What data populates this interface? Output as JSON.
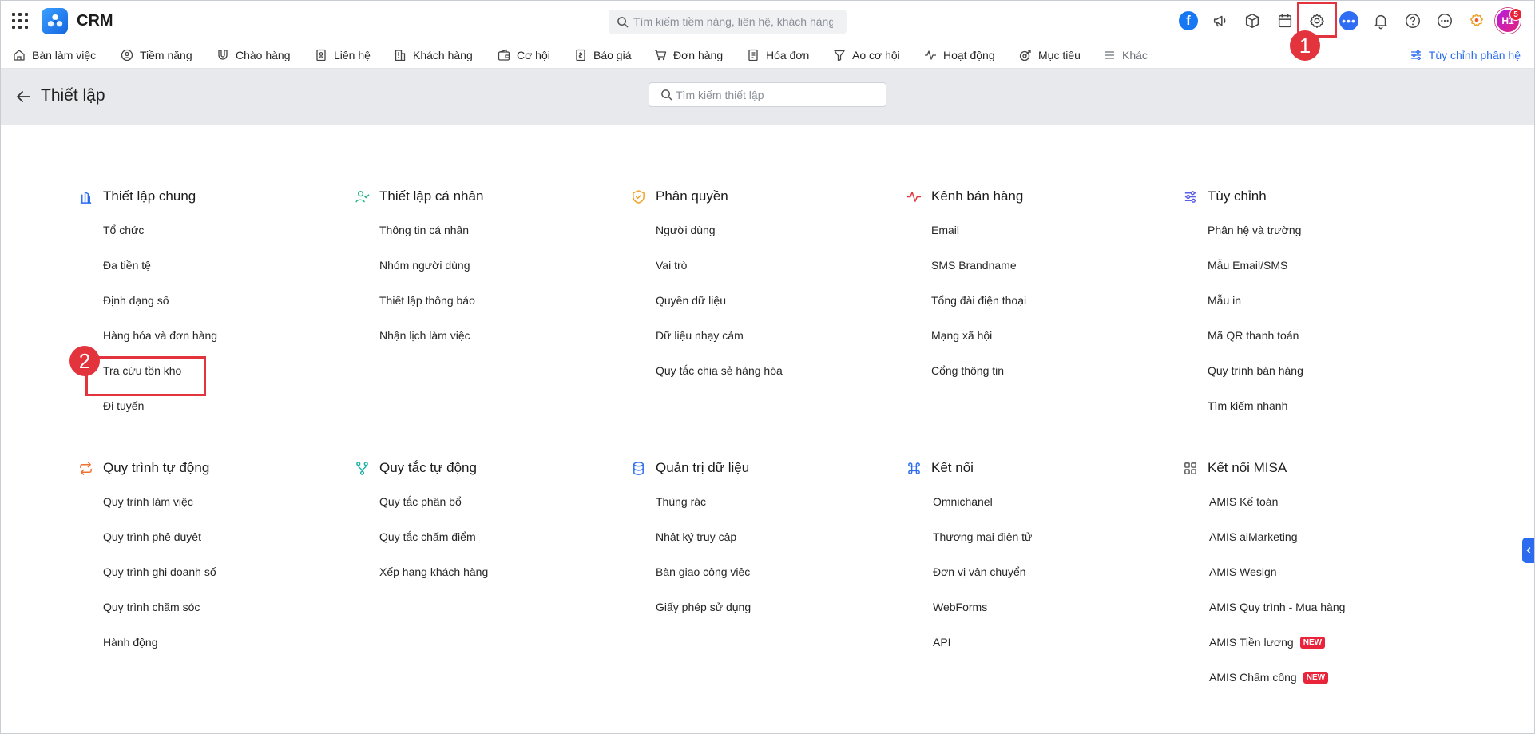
{
  "app": {
    "title": "CRM"
  },
  "global_search": {
    "placeholder": "Tìm kiếm tiềm năng, liên hệ, khách hàng"
  },
  "header": {
    "avatar_initials": "H1",
    "notification_count": "5"
  },
  "nav": {
    "items": [
      {
        "label": "Bàn làm việc",
        "icon": "home-icon"
      },
      {
        "label": "Tiềm năng",
        "icon": "user-circle-icon"
      },
      {
        "label": "Chào hàng",
        "icon": "magnet-icon"
      },
      {
        "label": "Liên hệ",
        "icon": "contact-card-icon"
      },
      {
        "label": "Khách hàng",
        "icon": "building-icon"
      },
      {
        "label": "Cơ hội",
        "icon": "wallet-icon"
      },
      {
        "label": "Báo giá",
        "icon": "quote-doc-icon"
      },
      {
        "label": "Đơn hàng",
        "icon": "cart-icon"
      },
      {
        "label": "Hóa đơn",
        "icon": "invoice-icon"
      },
      {
        "label": "Ao cơ hội",
        "icon": "funnel-icon"
      },
      {
        "label": "Hoạt động",
        "icon": "pulse-icon"
      },
      {
        "label": "Mục tiêu",
        "icon": "target-icon"
      },
      {
        "label": "Khác",
        "icon": "menu-icon"
      }
    ],
    "customize_label": "Tùy chỉnh phân hệ"
  },
  "settings": {
    "title": "Thiết lập",
    "search_placeholder": "Tìm kiếm thiết lập"
  },
  "callouts": {
    "one": "1",
    "two": "2"
  },
  "sections": [
    {
      "title": "Thiết lập chung",
      "icon": "building-columns-icon",
      "color": "#2a6bf0",
      "items": [
        "Tổ chức",
        "Đa tiền tệ",
        "Định dạng số",
        "Hàng hóa và đơn hàng",
        "Tra cứu tồn kho",
        "Đi tuyến"
      ]
    },
    {
      "title": "Thiết lập cá nhân",
      "icon": "user-check-icon",
      "color": "#19b37a",
      "items": [
        "Thông tin cá nhân",
        "Nhóm người dùng",
        "Thiết lập thông báo",
        "Nhận lịch làm việc"
      ]
    },
    {
      "title": "Phân quyền",
      "icon": "shield-check-icon",
      "color": "#f0a020",
      "items": [
        "Người dùng",
        "Vai trò",
        "Quyền dữ liệu",
        "Dữ liệu nhạy cảm",
        "Quy tắc chia sẻ hàng hóa"
      ]
    },
    {
      "title": "Kênh bán hàng",
      "icon": "pulse-icon",
      "color": "#e3343e",
      "items": [
        "Email",
        "SMS Brandname",
        "Tổng đài điện thoại",
        "Mạng xã hội",
        "Cổng thông tin"
      ]
    },
    {
      "title": "Tùy chỉnh",
      "icon": "sliders-icon",
      "color": "#5b5fe6",
      "items": [
        "Phân hệ và trường",
        "Mẫu Email/SMS",
        "Mẫu in",
        "Mã QR thanh toán",
        "Quy trình bán hàng",
        "Tìm kiếm nhanh"
      ]
    },
    {
      "title": "Quy trình tự động",
      "icon": "repeat-icon",
      "color": "#f07030",
      "items": [
        "Quy trình làm việc",
        "Quy trình phê duyệt",
        "Quy trình ghi doanh số",
        "Quy trình chăm sóc",
        "Hành động"
      ]
    },
    {
      "title": "Quy tắc tự động",
      "icon": "branch-icon",
      "color": "#19b3a0",
      "items": [
        "Quy tắc phân bổ",
        "Quy tắc chấm điểm",
        "Xếp hạng khách hàng"
      ]
    },
    {
      "title": "Quản trị dữ liệu",
      "icon": "database-icon",
      "color": "#2a6bf0",
      "items": [
        "Thùng rác",
        "Nhật ký truy cập",
        "Bàn giao công việc",
        "Giấy phép sử dụng"
      ]
    },
    {
      "title": "Kết nối",
      "icon": "command-icon",
      "color": "#2a6bf0",
      "items": [
        "Omnichanel",
        "Thương mại điện tử",
        "Đơn vị vận chuyển",
        "WebForms",
        "API"
      ]
    },
    {
      "title": "Kết nối MISA",
      "icon": "grid-squares-icon",
      "color": "#555555",
      "items": [
        "AMIS Kế toán",
        "AMIS aiMarketing",
        "AMIS Wesign",
        "AMIS Quy trình - Mua hàng",
        "AMIS Tiền lương",
        "AMIS Chấm công"
      ]
    }
  ],
  "badges": {
    "new": "NEW"
  }
}
